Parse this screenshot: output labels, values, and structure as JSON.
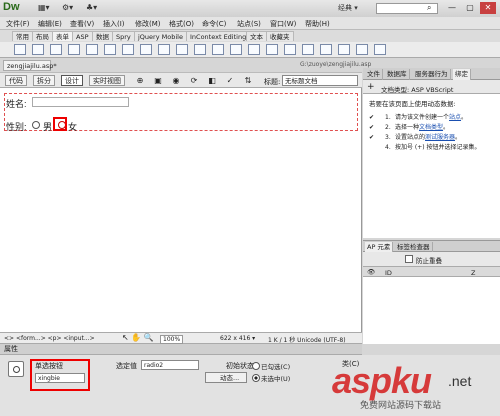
{
  "app": {
    "logo": "Dw",
    "workspace": "经典 ▾"
  },
  "titlebar_icons": [
    "▦▾",
    "⚙▾",
    "♣▾"
  ],
  "menus": [
    "文件(F)",
    "编辑(E)",
    "查看(V)",
    "插入(I)",
    "修改(M)",
    "格式(O)",
    "命令(C)",
    "站点(S)",
    "窗口(W)",
    "帮助(H)"
  ],
  "insert_tabs": [
    "常用",
    "布局",
    "表单",
    "ASP",
    "数据",
    "Spry",
    "jQuery Mobile",
    "InContext Editing",
    "文本",
    "收藏夹"
  ],
  "document": {
    "tab": "zengjiajilu.asp*",
    "path": "G:\\zuoye\\zengjiajilu.asp",
    "views": [
      "代码",
      "拆分",
      "设计",
      "实时视图"
    ],
    "title_label": "标题:",
    "title_value": "无标题文档"
  },
  "form": {
    "name_label": "姓名:",
    "gender_label": "性别:",
    "male": "男",
    "female": "女"
  },
  "status": {
    "tags": "<> <form...> <p> <input...>",
    "zoom": "100%",
    "size": "622 x 416 ▾",
    "info": "1 K / 1 秒  Unicode (UTF-8)"
  },
  "properties": {
    "header": "属性",
    "name_label": "单选按钮",
    "name_value": "xingbie",
    "value_label": "选定值",
    "value_value": "radio2",
    "initial_label": "初始状态",
    "checked": "已勾选(C)",
    "unchecked": "未选中(U)",
    "dynamic": "动态...",
    "class_label": "类(C)"
  },
  "panel_tabs": [
    "文件",
    "数据库",
    "服务器行为",
    "绑定"
  ],
  "bindings": {
    "doc_type": "文档类型: ASP VBScript",
    "intro": "若要在该页面上使用动态数据:",
    "steps": [
      {
        "num": "1.",
        "text": "请为该文件创建一个",
        "link": "站点",
        "after": "。"
      },
      {
        "num": "2.",
        "text": "选择一种",
        "link": "文档类型",
        "after": "。"
      },
      {
        "num": "3.",
        "text": "设置站点的",
        "link": "测试服务器",
        "after": "。"
      },
      {
        "num": "4.",
        "text": "按加号 (+) 按钮并选择记录集。",
        "link": "",
        "after": ""
      }
    ]
  },
  "ap": {
    "tabs": [
      "AP 元素",
      "标签检查器"
    ],
    "prevent_overlap": "防止重叠",
    "id_col": "ID",
    "z_col": "Z"
  },
  "watermark": {
    "main": "aspku",
    "net": ".net",
    "sub": "免费网站源码下载站"
  }
}
